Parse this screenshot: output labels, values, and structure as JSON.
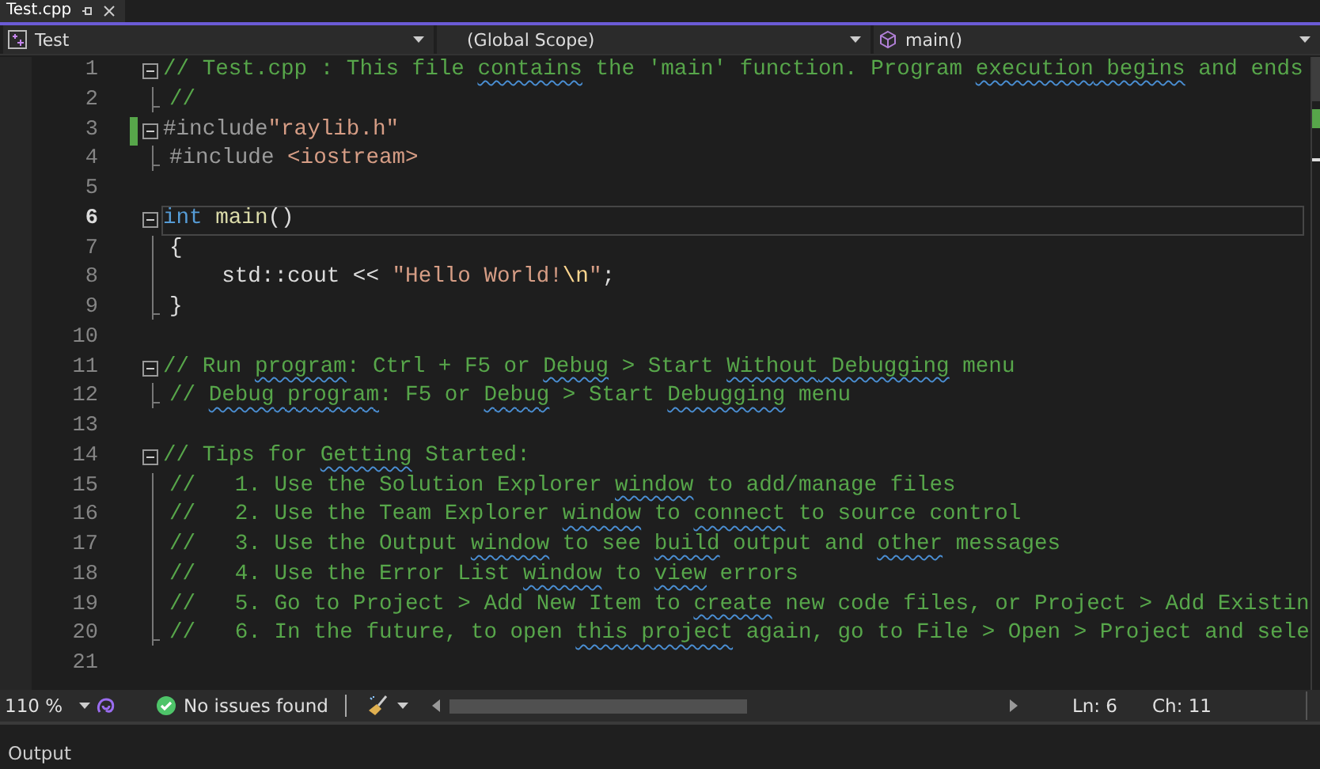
{
  "tab": {
    "title": "Test.cpp",
    "selected": true
  },
  "nav": {
    "project": "Test",
    "scope": "(Global Scope)",
    "member": "main()"
  },
  "lines": [
    {
      "number": "1",
      "collapsible": true,
      "changed": false,
      "current": false,
      "tokens": [
        {
          "kind": "comment",
          "text": "// Test.cpp : This file "
        },
        {
          "kind": "comment",
          "text": "contains",
          "spell": true
        },
        {
          "kind": "comment",
          "text": " the 'main' function. Program "
        },
        {
          "kind": "comment",
          "text": "execution",
          "spell": true
        },
        {
          "kind": "comment",
          "text": " begins",
          "spell": true
        },
        {
          "kind": "comment",
          "text": " and ends"
        }
      ]
    },
    {
      "number": "2",
      "collapsible": false,
      "changed": false,
      "current": false,
      "tokens": [
        {
          "kind": "comment",
          "text": "//"
        }
      ]
    },
    {
      "number": "3",
      "collapsible": true,
      "changed": true,
      "current": false,
      "tokens": [
        {
          "kind": "preproc",
          "text": "#include"
        },
        {
          "kind": "string",
          "text": "\"raylib.h\""
        }
      ]
    },
    {
      "number": "4",
      "collapsible": false,
      "changed": false,
      "current": false,
      "tokens": [
        {
          "kind": "preproc",
          "text": "#include "
        },
        {
          "kind": "string",
          "text": "<iostream>"
        }
      ]
    },
    {
      "number": "5",
      "collapsible": false,
      "changed": false,
      "current": false
    },
    {
      "number": "6",
      "collapsible": true,
      "changed": false,
      "current": true,
      "tokens": [
        {
          "kind": "keyword",
          "text": "int"
        },
        {
          "kind": "function",
          "text": " main"
        },
        {
          "kind": "plain",
          "text": "()"
        }
      ]
    },
    {
      "number": "7",
      "collapsible": false,
      "changed": false,
      "current": false,
      "tokens": [
        {
          "kind": "plain",
          "text": "{"
        }
      ]
    },
    {
      "number": "8",
      "collapsible": false,
      "changed": false,
      "current": false,
      "tokens": [
        {
          "kind": "plain",
          "text": "    std::cout << "
        },
        {
          "kind": "string",
          "text": "\"Hello World!"
        },
        {
          "kind": "escape",
          "text": "\\n"
        },
        {
          "kind": "string",
          "text": "\""
        },
        {
          "kind": "plain",
          "text": ";"
        }
      ]
    },
    {
      "number": "9",
      "collapsible": false,
      "changed": false,
      "current": false,
      "tokens": [
        {
          "kind": "plain",
          "text": "}"
        }
      ]
    },
    {
      "number": "10",
      "collapsible": false,
      "changed": false,
      "current": false
    },
    {
      "number": "11",
      "collapsible": true,
      "changed": false,
      "current": false,
      "tokens": [
        {
          "kind": "comment",
          "text": "// Run "
        },
        {
          "kind": "comment",
          "text": "program",
          "spell": true
        },
        {
          "kind": "comment",
          "text": ": Ctrl + F5 or "
        },
        {
          "kind": "comment",
          "text": "Debug",
          "spell": true
        },
        {
          "kind": "comment",
          "text": " > Start "
        },
        {
          "kind": "comment",
          "text": "Without",
          "spell": true
        },
        {
          "kind": "comment",
          "text": " Debugging",
          "spell": true
        },
        {
          "kind": "comment",
          "text": " menu"
        }
      ]
    },
    {
      "number": "12",
      "collapsible": false,
      "changed": false,
      "current": false,
      "tokens": [
        {
          "kind": "comment",
          "text": "// "
        },
        {
          "kind": "comment",
          "text": "Debug",
          "spell": true
        },
        {
          "kind": "comment",
          "text": " program",
          "spell": true
        },
        {
          "kind": "comment",
          "text": ": F5 or "
        },
        {
          "kind": "comment",
          "text": "Debug",
          "spell": true
        },
        {
          "kind": "comment",
          "text": " > Start "
        },
        {
          "kind": "comment",
          "text": "Debugging",
          "spell": true
        },
        {
          "kind": "comment",
          "text": " menu"
        }
      ]
    },
    {
      "number": "13",
      "collapsible": false,
      "changed": false,
      "current": false
    },
    {
      "number": "14",
      "collapsible": true,
      "changed": false,
      "current": false,
      "tokens": [
        {
          "kind": "comment",
          "text": "// Tips for "
        },
        {
          "kind": "comment",
          "text": "Getting",
          "spell": true
        },
        {
          "kind": "comment",
          "text": " Started:"
        }
      ]
    },
    {
      "number": "15",
      "collapsible": false,
      "changed": false,
      "current": false,
      "tokens": [
        {
          "kind": "comment",
          "text": "//   1. Use the Solution Explorer "
        },
        {
          "kind": "comment",
          "text": "window",
          "spell": true
        },
        {
          "kind": "comment",
          "text": " to add/manage files"
        }
      ]
    },
    {
      "number": "16",
      "collapsible": false,
      "changed": false,
      "current": false,
      "tokens": [
        {
          "kind": "comment",
          "text": "//   2. Use the Team Explorer "
        },
        {
          "kind": "comment",
          "text": "window",
          "spell": true
        },
        {
          "kind": "comment",
          "text": " to "
        },
        {
          "kind": "comment",
          "text": "connect",
          "spell": true
        },
        {
          "kind": "comment",
          "text": " to source control"
        }
      ]
    },
    {
      "number": "17",
      "collapsible": false,
      "changed": false,
      "current": false,
      "tokens": [
        {
          "kind": "comment",
          "text": "//   3. Use the Output "
        },
        {
          "kind": "comment",
          "text": "window",
          "spell": true
        },
        {
          "kind": "comment",
          "text": " to see "
        },
        {
          "kind": "comment",
          "text": "build",
          "spell": true
        },
        {
          "kind": "comment",
          "text": " output and "
        },
        {
          "kind": "comment",
          "text": "other",
          "spell": true
        },
        {
          "kind": "comment",
          "text": " messages"
        }
      ]
    },
    {
      "number": "18",
      "collapsible": false,
      "changed": false,
      "current": false,
      "tokens": [
        {
          "kind": "comment",
          "text": "//   4. Use the Error List "
        },
        {
          "kind": "comment",
          "text": "window",
          "spell": true
        },
        {
          "kind": "comment",
          "text": " to "
        },
        {
          "kind": "comment",
          "text": "view",
          "spell": true
        },
        {
          "kind": "comment",
          "text": " errors"
        }
      ]
    },
    {
      "number": "19",
      "collapsible": false,
      "changed": false,
      "current": false,
      "tokens": [
        {
          "kind": "comment",
          "text": "//   5. Go to Project > Add New Item to "
        },
        {
          "kind": "comment",
          "text": "create",
          "spell": true
        },
        {
          "kind": "comment",
          "text": " new code files, or Project > Add Existin"
        }
      ]
    },
    {
      "number": "20",
      "collapsible": false,
      "changed": false,
      "current": false,
      "tokens": [
        {
          "kind": "comment",
          "text": "//   6. In the future, to open "
        },
        {
          "kind": "comment",
          "text": "this",
          "spell": true
        },
        {
          "kind": "comment",
          "text": " project",
          "spell": true
        },
        {
          "kind": "comment",
          "text": " again, go to File > Open > Project and sele"
        }
      ]
    },
    {
      "number": "21",
      "collapsible": false,
      "changed": false,
      "current": false
    }
  ],
  "status_bar": {
    "zoom": "110 %",
    "issues": "No issues found",
    "line": "Ln: 6",
    "column": "Ch: 11"
  },
  "output_panel": {
    "title": "Output"
  }
}
